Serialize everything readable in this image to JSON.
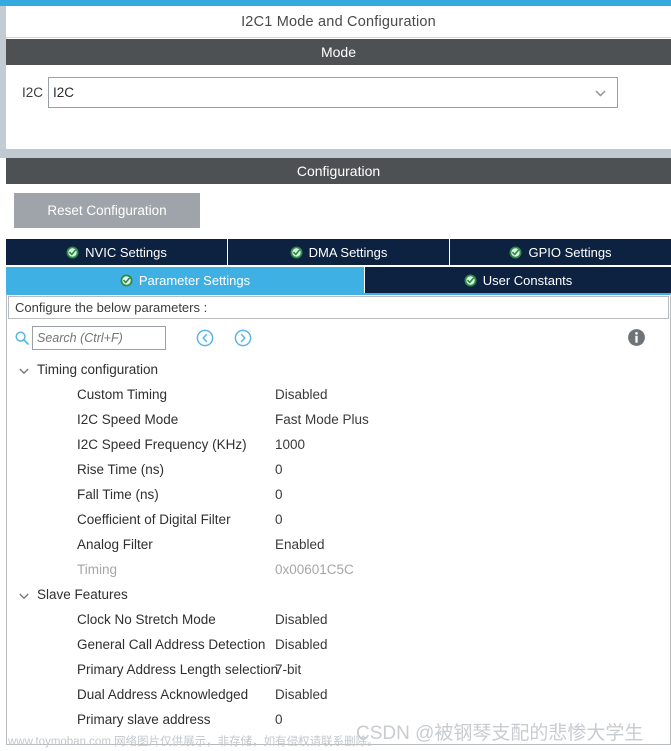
{
  "accent_color": "#3fb0e4",
  "tab_bg_color": "#0d2240",
  "band_color": "#4e5153",
  "header": {
    "title": "I2C1 Mode and Configuration"
  },
  "mode_section": {
    "band_title": "Mode",
    "label": "I2C",
    "selected": "I2C",
    "caret_icon": "chevron-down-icon"
  },
  "config_section": {
    "band_title": "Configuration",
    "reset_button": "Reset Configuration"
  },
  "tabs_row1": [
    {
      "label": "NVIC Settings",
      "icon": "green-check-icon",
      "active": false
    },
    {
      "label": "DMA Settings",
      "icon": "green-check-icon",
      "active": false
    },
    {
      "label": "GPIO Settings",
      "icon": "green-check-icon",
      "active": false
    }
  ],
  "tabs_row2": [
    {
      "label": "Parameter Settings",
      "icon": "green-check-icon",
      "active": true
    },
    {
      "label": "User Constants",
      "icon": "green-check-icon",
      "active": false
    }
  ],
  "panel": {
    "configure_label": "Configure the below parameters :",
    "search_placeholder": "Search (Ctrl+F)",
    "search_value": "",
    "search_icon": "search-icon",
    "prev_icon": "previous-match-icon",
    "next_icon": "next-match-icon",
    "info_icon": "info-icon"
  },
  "groups": [
    {
      "name": "Timing configuration",
      "expanded": true,
      "chevron_icon": "chevron-down-icon",
      "params": [
        {
          "name": "Custom Timing",
          "value": "Disabled",
          "disabled": false
        },
        {
          "name": "I2C Speed Mode",
          "value": "Fast Mode Plus",
          "disabled": false
        },
        {
          "name": "I2C Speed Frequency (KHz)",
          "value": "1000",
          "disabled": false
        },
        {
          "name": "Rise Time (ns)",
          "value": "0",
          "disabled": false
        },
        {
          "name": "Fall Time (ns)",
          "value": "0",
          "disabled": false
        },
        {
          "name": "Coefficient of Digital Filter",
          "value": "0",
          "disabled": false
        },
        {
          "name": "Analog Filter",
          "value": "Enabled",
          "disabled": false
        },
        {
          "name": "Timing",
          "value": "0x00601C5C",
          "disabled": true
        }
      ]
    },
    {
      "name": "Slave Features",
      "expanded": true,
      "chevron_icon": "chevron-down-icon",
      "params": [
        {
          "name": "Clock No Stretch Mode",
          "value": "Disabled",
          "disabled": false
        },
        {
          "name": "General Call Address Detection",
          "value": "Disabled",
          "disabled": false
        },
        {
          "name": "Primary Address Length selection",
          "value": "7-bit",
          "disabled": false
        },
        {
          "name": "Dual Address Acknowledged",
          "value": "Disabled",
          "disabled": false
        },
        {
          "name": "Primary slave address",
          "value": "0",
          "disabled": false
        }
      ]
    }
  ],
  "watermarks": {
    "csdn": "CSDN @被钢琴支配的悲惨大学生",
    "toymoban": "www.toymoban.com 网络图片仅供展示，非存储，如有侵权请联系删除。"
  }
}
